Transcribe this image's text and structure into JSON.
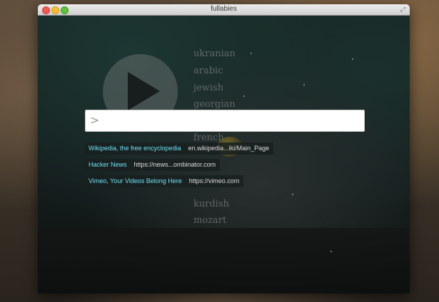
{
  "window": {
    "title": "fullabies"
  },
  "languages": [
    "ukranian",
    "arabic",
    "jewish",
    "georgian",
    "french",
    "kurdish",
    "mozart"
  ],
  "search": {
    "prompt_symbol": ">",
    "value": "",
    "placeholder": ""
  },
  "results": [
    {
      "title": "Wikipedia, the free encyclopedia",
      "url": "en.wikipedia...iki/Main_Page"
    },
    {
      "title": "Hacker News",
      "url": "https://news...ombinator.com"
    },
    {
      "title": "Vimeo, Your Videos Belong Here",
      "url": "https://vimeo.com"
    }
  ],
  "colors": {
    "result_title": "#6ee0f5",
    "result_url": "#dcdcdc",
    "close": "#ee5a52",
    "minimize": "#f5bd31",
    "zoom": "#5fc23e"
  },
  "icons": {
    "play": "play-icon",
    "fullscreen": "fullscreen-icon"
  }
}
